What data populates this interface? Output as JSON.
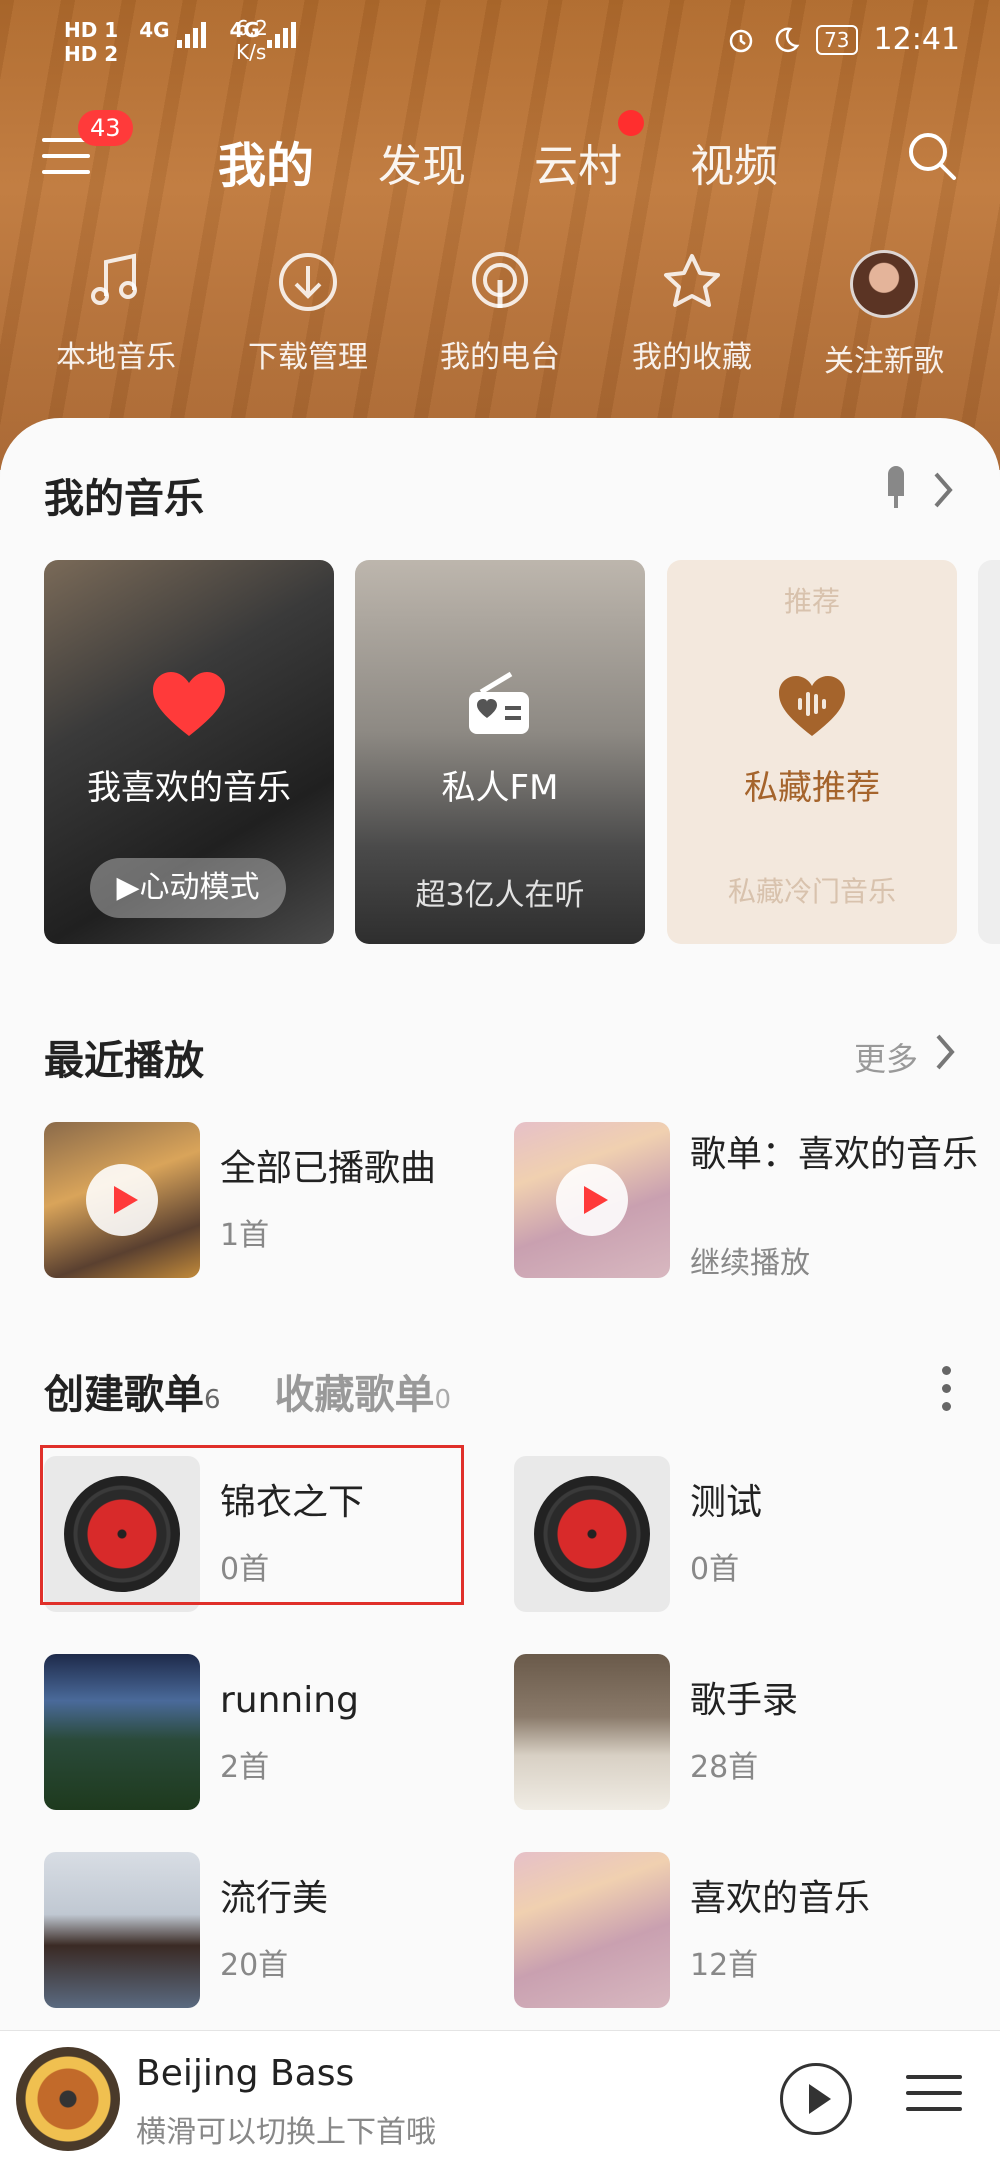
{
  "status_bar": {
    "hd_labels": [
      "HD 1",
      "HD 2"
    ],
    "net_labels": [
      "4G",
      "4G"
    ],
    "speed_value": "6.2",
    "speed_unit": "K/s",
    "battery": "73",
    "time": "12:41"
  },
  "header": {
    "notification_badge": "43",
    "tabs": [
      {
        "label": "我的",
        "active": true
      },
      {
        "label": "发现",
        "active": false
      },
      {
        "label": "云村",
        "active": false,
        "dot": true
      },
      {
        "label": "视频",
        "active": false
      }
    ]
  },
  "shortcuts": [
    {
      "label": "本地音乐",
      "icon": "music-note-icon"
    },
    {
      "label": "下载管理",
      "icon": "download-icon"
    },
    {
      "label": "我的电台",
      "icon": "podcast-icon"
    },
    {
      "label": "我的收藏",
      "icon": "star-icon"
    },
    {
      "label": "关注新歌",
      "icon": "avatar"
    }
  ],
  "my_music": {
    "title": "我的音乐",
    "cards": [
      {
        "title": "我喜欢的音乐",
        "sub": "心动模式"
      },
      {
        "title": "私人FM",
        "sub": "超3亿人在听"
      },
      {
        "top": "推荐",
        "title": "私藏推荐",
        "sub": "私藏冷门音乐"
      }
    ]
  },
  "recent": {
    "title": "最近播放",
    "more": "更多",
    "items": [
      {
        "name": "全部已播歌曲",
        "count": "1首"
      },
      {
        "name": "歌单：喜欢的音乐",
        "count": "继续播放"
      }
    ]
  },
  "playlists": {
    "created_label": "创建歌单",
    "created_count": "6",
    "fav_label": "收藏歌单",
    "fav_count": "0",
    "items": [
      {
        "name": "锦衣之下",
        "count": "0首"
      },
      {
        "name": "测试",
        "count": "0首"
      },
      {
        "name": "running",
        "count": "2首"
      },
      {
        "name": "歌手录",
        "count": "28首"
      },
      {
        "name": "流行美",
        "count": "20首"
      },
      {
        "name": "喜欢的音乐",
        "count": "12首"
      }
    ]
  },
  "player": {
    "title": "Beijing Bass",
    "subtitle": "横滑可以切换上下首哦"
  },
  "colors": {
    "accent": "#ff3a3a",
    "hero": "#b06a2c",
    "recommend": "#a5642c"
  }
}
